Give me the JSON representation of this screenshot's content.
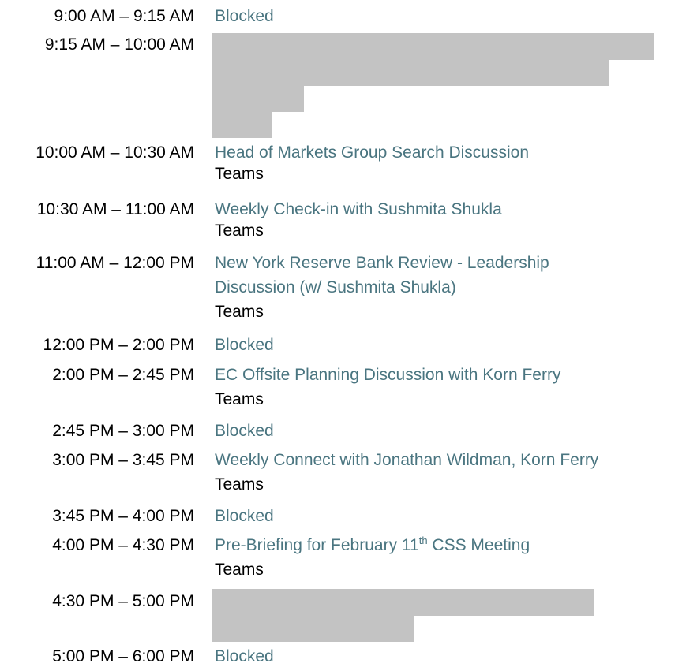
{
  "schedule": [
    {
      "time": "9:00 AM – 9:15 AM",
      "title": "Blocked"
    },
    {
      "time": "9:15 AM – 10:00 AM",
      "redacted": true
    },
    {
      "time": "10:00 AM – 10:30 AM",
      "title": "Head of Markets Group Search Discussion",
      "location": "Teams"
    },
    {
      "time": "10:30 AM – 11:00 AM",
      "title": "Weekly Check-in with Sushmita Shukla",
      "location": "Teams"
    },
    {
      "time": "11:00 AM – 12:00 PM",
      "title_line1": "New York Reserve Bank Review - Leadership",
      "title_line2": "Discussion (w/ Sushmita Shukla)",
      "location": "Teams"
    },
    {
      "time": "12:00 PM – 2:00 PM",
      "title": "Blocked"
    },
    {
      "time": "2:00 PM – 2:45 PM",
      "title": "EC Offsite Planning Discussion with Korn Ferry",
      "location": "Teams"
    },
    {
      "time": "2:45 PM – 3:00 PM",
      "title": "Blocked"
    },
    {
      "time": "3:00 PM – 3:45 PM",
      "title": "Weekly Connect with Jonathan Wildman, Korn Ferry",
      "location": "Teams"
    },
    {
      "time": "3:45 PM – 4:00 PM",
      "title": "Blocked"
    },
    {
      "time": "4:00 PM – 4:30 PM",
      "title_pre": "Pre-Briefing for February 11",
      "title_sup": "th",
      "title_post": " CSS Meeting",
      "location": "Teams"
    },
    {
      "time": "4:30 PM – 5:00 PM",
      "redacted": true
    },
    {
      "time": "5:00 PM – 6:00 PM",
      "title": "Blocked"
    }
  ],
  "colors": {
    "link": "#4a7580",
    "text": "#000000",
    "redaction": "#c3c3c3"
  }
}
